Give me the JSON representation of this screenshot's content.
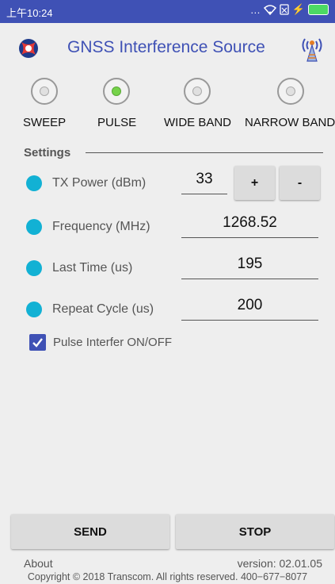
{
  "status_bar": {
    "time": "上午10:24",
    "icons": [
      "more-icon",
      "wifi-icon",
      "sim-icon",
      "charging-icon",
      "battery-icon"
    ]
  },
  "header": {
    "title": "GNSS Interference Source",
    "logo_icon": "transcom-logo-icon",
    "antenna_icon": "antenna-icon"
  },
  "modes": {
    "options": [
      {
        "label": "SWEEP",
        "selected": false
      },
      {
        "label": "PULSE",
        "selected": true
      },
      {
        "label": "WIDE BAND",
        "selected": false
      },
      {
        "label": "NARROW BAND",
        "selected": false
      }
    ]
  },
  "settings": {
    "header": "Settings",
    "tx_power": {
      "label": "TX Power (dBm)",
      "value": "33",
      "plus": "+",
      "minus": "-"
    },
    "frequency": {
      "label": "Frequency (MHz)",
      "value": "1268.52"
    },
    "last_time": {
      "label": "Last Time (us)",
      "value": "195"
    },
    "repeat_cycle": {
      "label": "Repeat Cycle (us)",
      "value": "200"
    },
    "pulse_toggle": {
      "label": "Pulse Interfer ON/OFF",
      "checked": true
    }
  },
  "actions": {
    "send": "SEND",
    "stop": "STOP"
  },
  "footer": {
    "about": "About",
    "version": "version: 02.01.05",
    "copyright": "Copyright © 2018 Transcom. All rights reserved. 400−677−8077"
  },
  "colors": {
    "primary": "#3f51b5",
    "bullet": "#12b1d4",
    "radio_selected": "#76d34a",
    "background": "#eeeeee"
  }
}
